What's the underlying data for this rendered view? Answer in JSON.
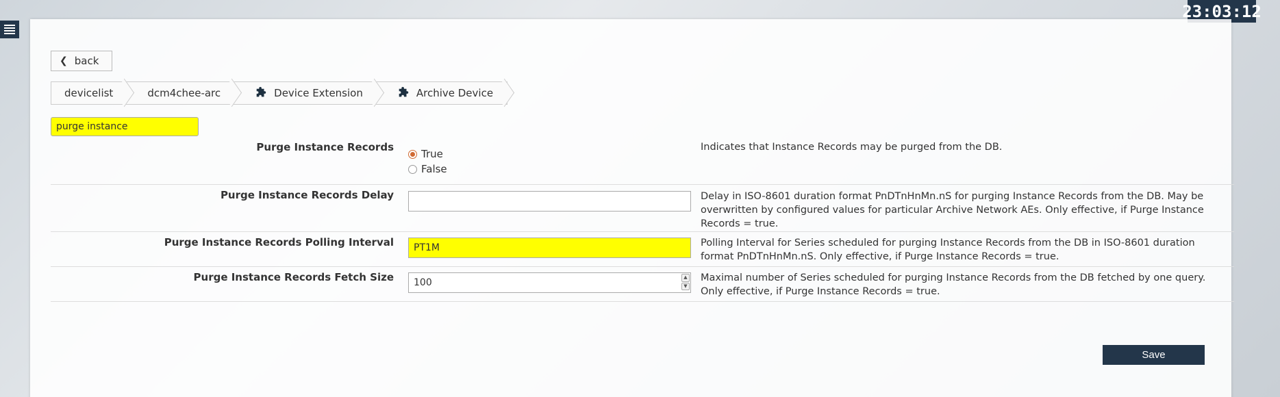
{
  "clock": "23:03:12",
  "back_label": "back",
  "breadcrumbs": [
    "devicelist",
    "dcm4chee-arc",
    "Device Extension",
    "Archive Device"
  ],
  "filter": {
    "value": "purge instance"
  },
  "rows": [
    {
      "label": "Purge Instance Records",
      "options": [
        "True",
        "False"
      ],
      "selected": "True",
      "description": "Indicates that Instance Records may be purged from the DB."
    },
    {
      "label": "Purge Instance Records Delay",
      "value": "",
      "description": "Delay in ISO-8601 duration format PnDTnHnMn.nS for purging Instance Records from the DB. May be overwritten by configured values for particular Archive Network AEs. Only effective, if Purge Instance Records = true."
    },
    {
      "label": "Purge Instance Records Polling Interval",
      "value": "PT1M",
      "description": "Polling Interval for Series scheduled for purging Instance Records from the DB in ISO-8601 duration format PnDTnHnMn.nS. Only effective, if Purge Instance Records = true."
    },
    {
      "label": "Purge Instance Records Fetch Size",
      "value": "100",
      "description": "Maximal number of Series scheduled for purging Instance Records from the DB fetched by one query. Only effective, if Purge Instance Records = true."
    }
  ],
  "save_label": "Save",
  "colors": {
    "accent": "#23364a",
    "highlight": "#ffff00",
    "radio": "#d06a33"
  },
  "icons": {
    "menu": "hamburger-icon",
    "back": "chevron-left-icon",
    "extension": "puzzle-icon"
  }
}
